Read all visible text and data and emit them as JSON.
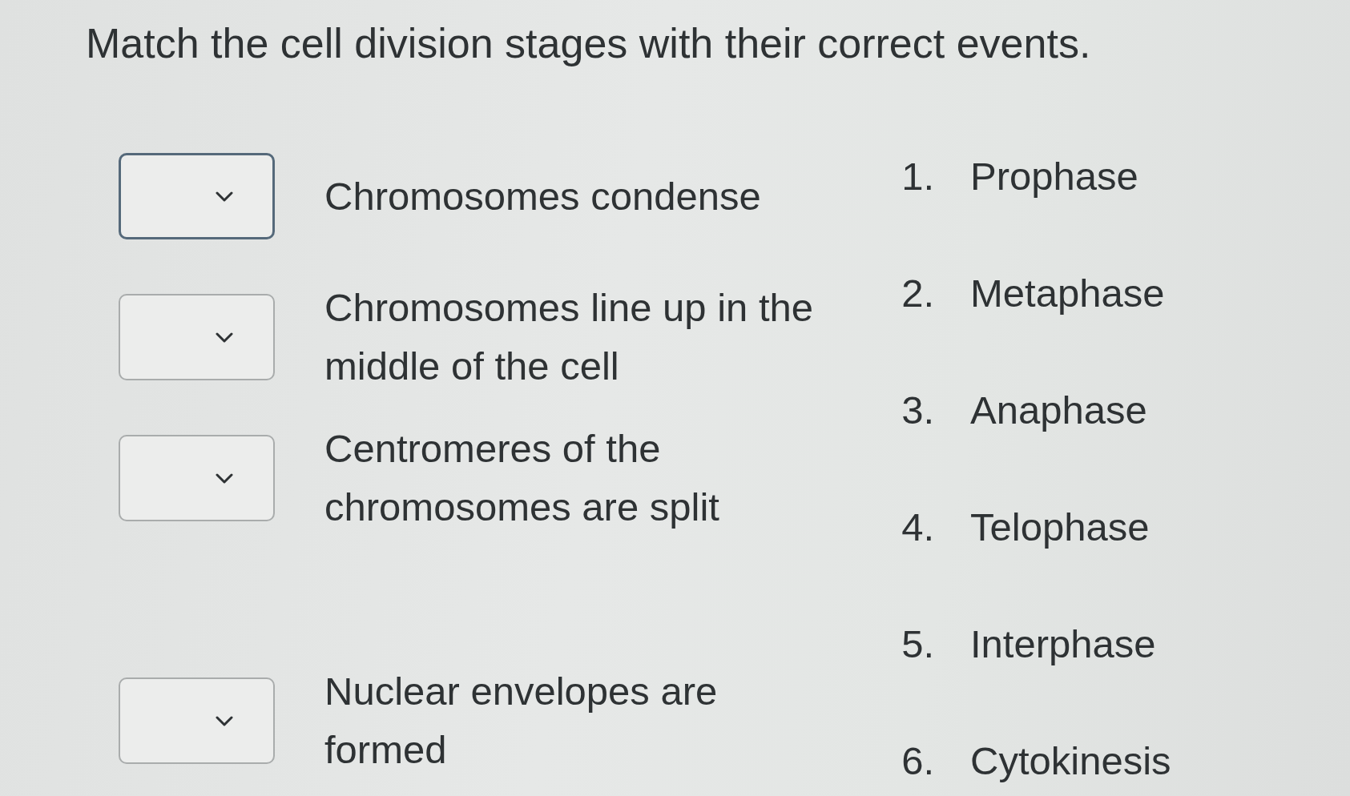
{
  "title": "Match the cell division stages with their correct events.",
  "matches": [
    {
      "statement": "Chromosomes condense",
      "focused": true
    },
    {
      "statement": "Chromosomes line up in the middle of the cell",
      "focused": false
    },
    {
      "statement": "Centromeres of the chromosomes are split",
      "focused": false
    },
    {
      "statement": "Nuclear envelopes are formed",
      "focused": false
    }
  ],
  "stages": [
    {
      "number": "1.",
      "name": "Prophase"
    },
    {
      "number": "2.",
      "name": "Metaphase"
    },
    {
      "number": "3.",
      "name": "Anaphase"
    },
    {
      "number": "4.",
      "name": "Telophase"
    },
    {
      "number": "5.",
      "name": "Interphase"
    },
    {
      "number": "6.",
      "name": "Cytokinesis"
    }
  ]
}
